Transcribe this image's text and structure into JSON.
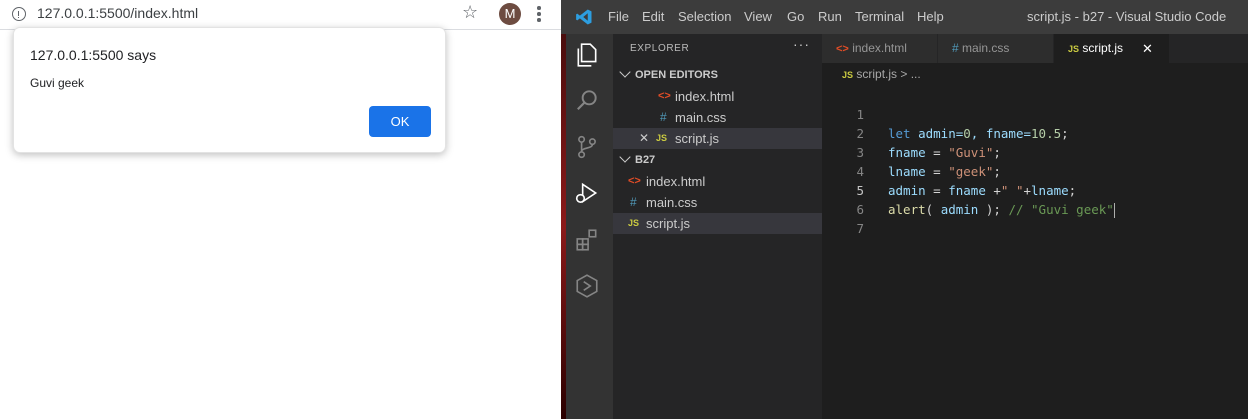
{
  "browser": {
    "url": "127.0.0.1:5500/index.html",
    "profile_initial": "M",
    "icons": {
      "info": "info-icon",
      "star": "bookmark-star-icon",
      "menu": "kebab-menu-icon"
    },
    "alert": {
      "title": "127.0.0.1:5500 says",
      "message": "Guvi geek",
      "ok_label": "OK",
      "ok_color": "#1a73e8"
    }
  },
  "vscode": {
    "menu": [
      "File",
      "Edit",
      "Selection",
      "View",
      "Go",
      "Run",
      "Terminal",
      "Help"
    ],
    "window_title": "script.js - b27 - Visual Studio Code",
    "explorer": {
      "title": "EXPLORER",
      "more": "···",
      "open_editors_label": "OPEN EDITORS",
      "open_editors": [
        {
          "name": "index.html",
          "icon": "<>"
        },
        {
          "name": "main.css",
          "icon": "#"
        },
        {
          "name": "script.js",
          "icon": "JS",
          "close": "✕"
        }
      ],
      "folder_label": "B27",
      "folder_files": [
        {
          "name": "index.html",
          "icon": "<>"
        },
        {
          "name": "main.css",
          "icon": "#"
        },
        {
          "name": "script.js",
          "icon": "JS"
        }
      ]
    },
    "tabs": [
      {
        "name": "index.html",
        "icon": "<>"
      },
      {
        "name": "main.css",
        "icon": "#"
      },
      {
        "name": "script.js",
        "icon": "JS",
        "close": "✕"
      }
    ],
    "breadcrumb": {
      "icon": "JS",
      "file": "script.js",
      "more": "> ..."
    },
    "code": {
      "line_numbers": [
        "1",
        "2",
        "3",
        "4",
        "5",
        "6",
        "7"
      ],
      "l1": {
        "kw": "let",
        "p1": " admin=",
        "n1": "0",
        "p2": ", fname=",
        "n2": "10.5",
        "p3": ";"
      },
      "l2": {
        "var": "fname",
        "op": " = ",
        "str": "\"Guvi\"",
        "end": ";"
      },
      "l3": {
        "var": "lname",
        "op": " = ",
        "str": "\"geek\"",
        "end": ";"
      },
      "l4": {
        "var": "admin",
        "op1": " = ",
        "var2": "fname",
        "op2": " +",
        "str": "\" \"",
        "op3": "+",
        "var3": "lname",
        "end": ";"
      },
      "l5": {
        "fn": "alert",
        "open": "( ",
        "var": "admin",
        "close": " ); ",
        "cmt": "// \"Guvi geek\""
      }
    }
  }
}
